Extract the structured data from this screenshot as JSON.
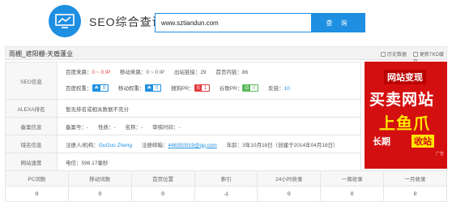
{
  "header": {
    "brand": "SEO综合查询",
    "search_value": "www.sztiandun.com",
    "search_button": "查 询"
  },
  "title_bar": {
    "title": "雨棚_遮阳棚-天盾蓬业",
    "action_history": "历史数据",
    "action_refresh": "更新TKD缓存"
  },
  "seo": {
    "label": "SEO信息",
    "baidu_source_label": "百度来路：",
    "baidu_source_value": "0 ~ 0 IP",
    "mobile_source_label": "移动来路：",
    "mobile_source_value": "0 ~ 0 IP",
    "outlinks_label": "出站链接：",
    "outlinks_value": "29",
    "home_inlinks_label": "首页内链：",
    "home_inlinks_value": "86",
    "baidu_weight_label": "百度权重：",
    "baidu_weight_value": "0",
    "mobile_weight_label": "移动权重：",
    "mobile_weight_value": "0",
    "sogou_pr_label": "搜狗PR：",
    "sogou_pr_value": "1",
    "google_pr_label": "谷歌PR：",
    "google_pr_value": "0",
    "backlinks_label": "反链：",
    "backlinks_value": "10"
  },
  "alexa": {
    "label": "ALEXA排名",
    "value": "暂无排名或相关数据不充分"
  },
  "icp": {
    "label": "备案信息",
    "no_label": "备案号：",
    "no_value": "-",
    "nature_label": "性质：",
    "nature_value": "-",
    "name_label": "名称：",
    "name_value": "-",
    "time_label": "审核时间：",
    "time_value": "-"
  },
  "domain": {
    "label": "域名信息",
    "registrant_label": "注册人/机构：",
    "registrant_value": "GuGuo Zheng",
    "email_label": "注册邮箱：",
    "email_value": "446350919@qq.com",
    "age_label": "年龄：",
    "age_value": "3年10月18日",
    "created_value": "（创建于2014年04月18日）"
  },
  "speed": {
    "label": "网站速度",
    "value": "电信：598.17毫秒"
  },
  "ad": {
    "line1": "网站变现",
    "line2": "买卖网站",
    "line3": "上鱼爪",
    "line4": "长期",
    "line5": "收站",
    "tag": "广告"
  },
  "stats": {
    "headers": [
      "PC词数",
      "移动词数",
      "首页位置",
      "索引",
      "24小时收录",
      "一周收录",
      "一月收录"
    ],
    "values": [
      "0",
      "0",
      "0",
      "-1",
      "0",
      "0",
      "0"
    ]
  }
}
